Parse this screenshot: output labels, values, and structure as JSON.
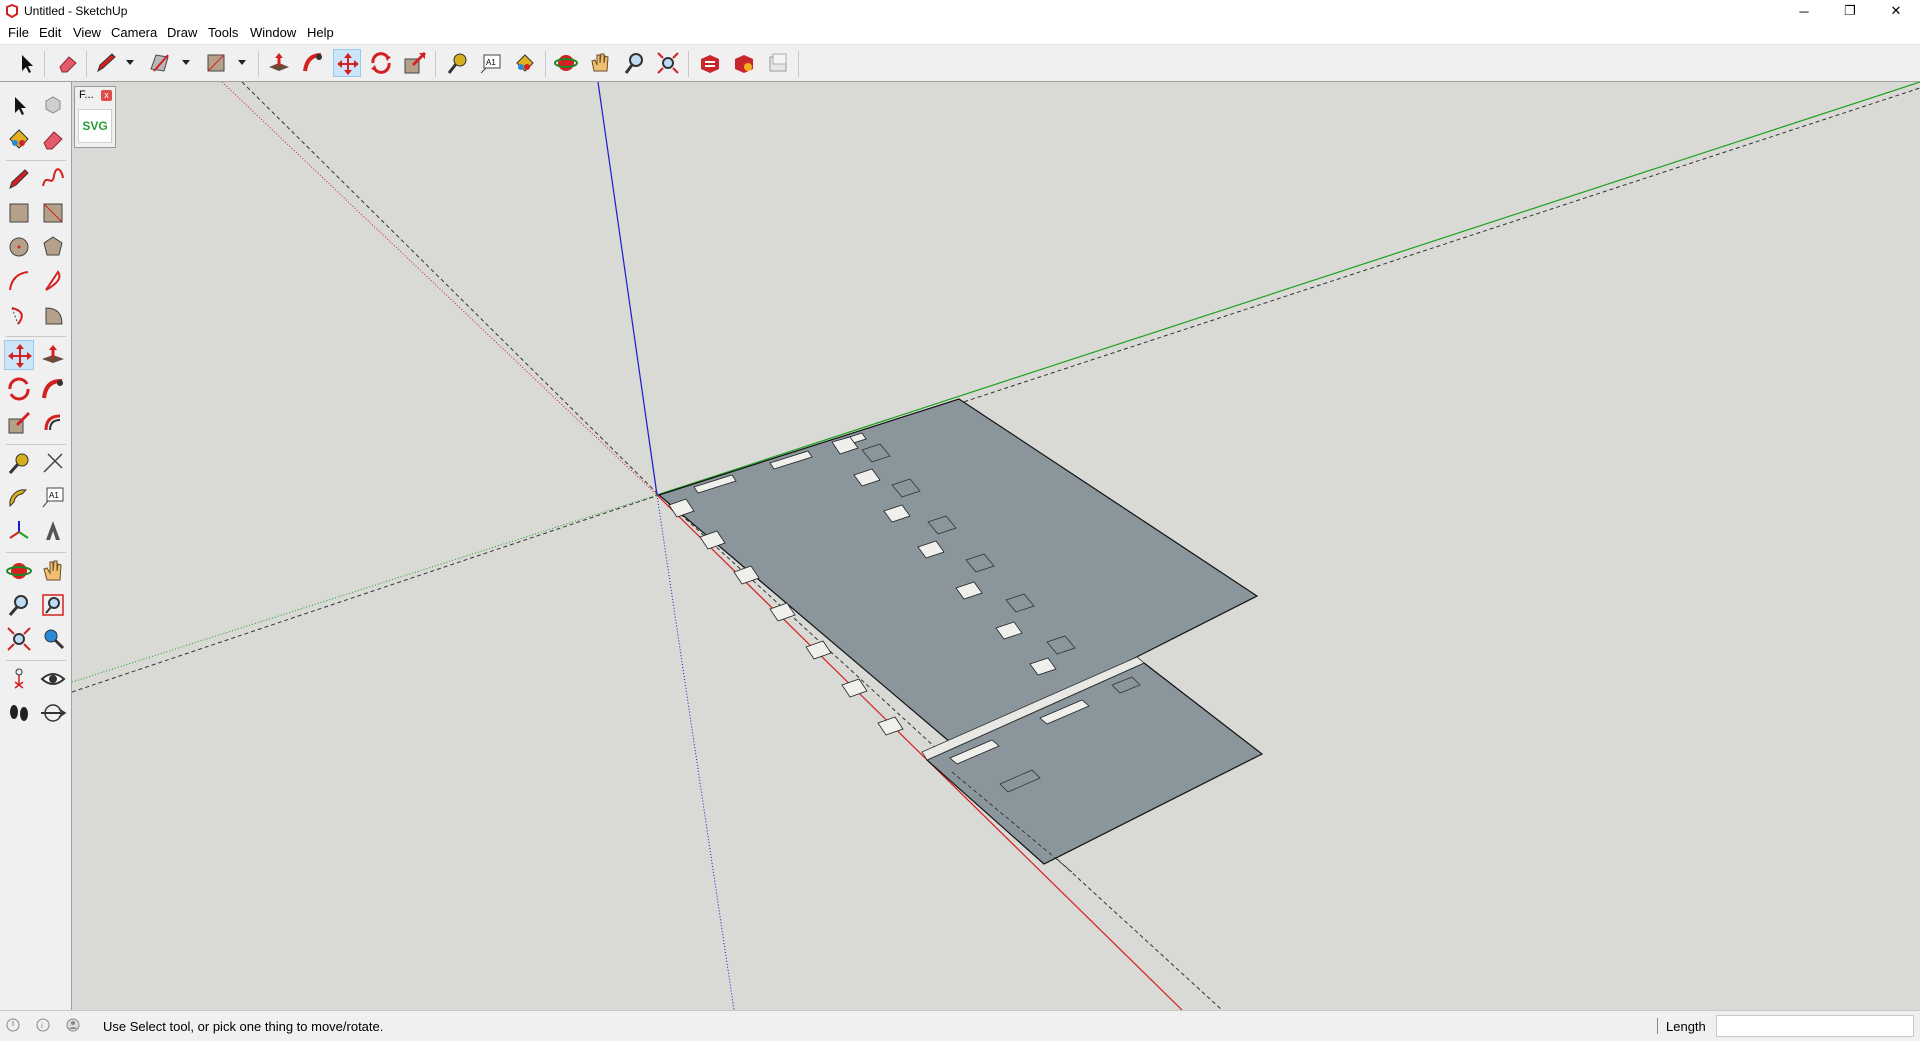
{
  "window": {
    "title": "Untitled - SketchUp",
    "minimize_glyph": "─",
    "maximize_glyph": "❐",
    "close_glyph": "✕"
  },
  "menu": {
    "items": [
      "File",
      "Edit",
      "View",
      "Camera",
      "Draw",
      "Tools",
      "Window",
      "Help"
    ]
  },
  "toolbar": {
    "icons": [
      "select-icon",
      "eraser-icon",
      "pencil-icon",
      "freehand-icon",
      "rectangle-icon",
      "push-pull-icon",
      "follow-me-icon",
      "move-icon",
      "rotate-icon",
      "scale-icon",
      "tape-measure-icon",
      "text-icon",
      "paint-bucket-icon",
      "orbit-icon",
      "pan-icon",
      "zoom-icon",
      "zoom-extents-icon",
      "3d-warehouse-icon",
      "extension-warehouse-icon",
      "layout-icon"
    ],
    "active": "move-icon"
  },
  "left_toolbar": {
    "active": "move-icon"
  },
  "extension_panel": {
    "title": "F...",
    "close_glyph": "x",
    "button_label": "SVG"
  },
  "viewport": {
    "background": "#d9d9d6",
    "face_color": "#8a969c",
    "axis_red": "#d42020",
    "axis_green": "#1ea01e",
    "axis_blue": "#1a1ad0"
  },
  "status": {
    "hint": "Use Select tool, or pick one thing to move/rotate.",
    "vcb_label": "Length",
    "vcb_value": ""
  }
}
